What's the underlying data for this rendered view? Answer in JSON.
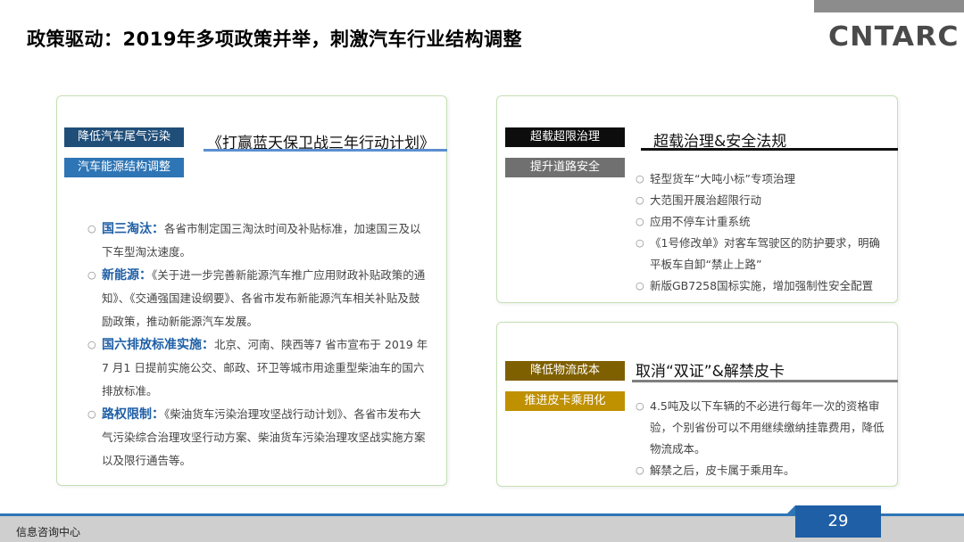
{
  "title": "政策驱动：2019年多项政策并举，刺激汽车行业结构调整",
  "logo": "CNTARC",
  "left_panel": {
    "tags": [
      "降低汽车尾气污染",
      "汽车能源结构调整"
    ],
    "heading": "《打赢蓝天保卫战三年行动计划》",
    "items": [
      {
        "kw": "国三淘汰：",
        "text": "各省市制定国三淘汰时间及补贴标准，加速国三及以下车型淘汰速度。"
      },
      {
        "kw": "新能源：",
        "text": "《关于进一步完善新能源汽车推广应用财政补贴政策的通知》、《交通强国建设纲要》、各省市发布新能源汽车相关补贴及鼓励政策，推动新能源汽车发展。"
      },
      {
        "kw": "国六排放标准实施：",
        "text": "北京、河南、陕西等7 省市宣布于 2019 年7 月1 日提前实施公交、邮政、环卫等城市用途重型柴油车的国六排放标准。"
      },
      {
        "kw": "路权限制：",
        "text": "《柴油货车污染治理攻坚战行动计划》、各省市发布大气污染综合治理攻坚行动方案、柴油货车污染治理攻坚战实施方案以及限行通告等。"
      }
    ]
  },
  "right_top_panel": {
    "tags": [
      "超载超限治理",
      "提升道路安全"
    ],
    "heading": "超载治理&安全法规",
    "items": [
      "轻型货车“大吨小标”专项治理",
      "大范围开展治超限行动",
      "应用不停车计重系统",
      "《1号修改单》对客车驾驶区的防护要求，明确平板车自卸“禁止上路”",
      "新版GB7258国标实施，增加强制性安全配置"
    ]
  },
  "right_bottom_panel": {
    "tags": [
      "降低物流成本",
      "推进皮卡乘用化"
    ],
    "heading": "取消“双证”&解禁皮卡",
    "items": [
      "4.5吨及以下车辆的不必进行每年一次的资格审验，个别省份可以不用继续缴纳挂靠费用，降低物流成本。",
      "解禁之后，皮卡属于乘用车。"
    ]
  },
  "footer": {
    "label": "信息咨询中心",
    "page_number": "29"
  },
  "colors": {
    "accent_blue": "#2e75b6",
    "keyword_blue": "#1f5fa6",
    "panel_border": "#c5e0b4"
  }
}
